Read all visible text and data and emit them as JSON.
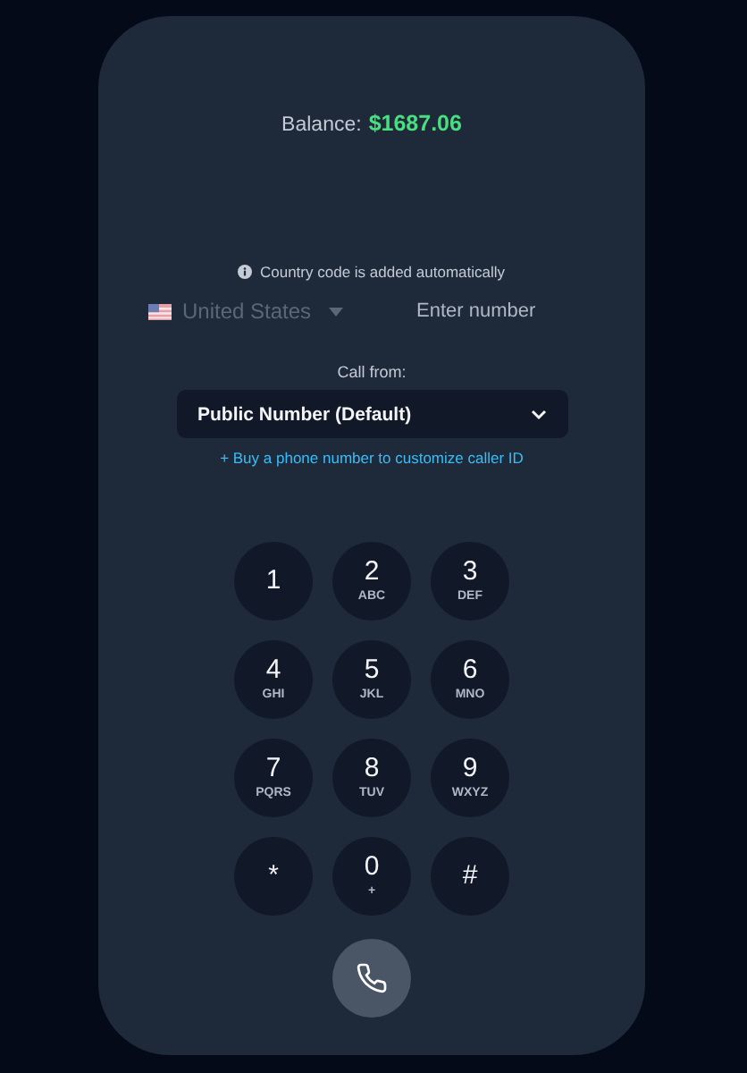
{
  "balance": {
    "label": "Balance:",
    "amount": "$1687.06"
  },
  "info": "Country code is added automatically",
  "country": {
    "name": "United States"
  },
  "number_field": {
    "placeholder": "Enter number"
  },
  "call_from": {
    "label": "Call from:",
    "value": "Public Number (Default)"
  },
  "buy_link": "+ Buy a phone number to customize caller ID",
  "keys": [
    {
      "digit": "1"
    },
    {
      "digit": "2",
      "letters": "ABC"
    },
    {
      "digit": "3",
      "letters": "DEF"
    },
    {
      "digit": "4",
      "letters": "GHI"
    },
    {
      "digit": "5",
      "letters": "JKL"
    },
    {
      "digit": "6",
      "letters": "MNO"
    },
    {
      "digit": "7",
      "letters": "PQRS"
    },
    {
      "digit": "8",
      "letters": "TUV"
    },
    {
      "digit": "9",
      "letters": "WXYZ"
    },
    {
      "digit": "*"
    },
    {
      "digit": "0",
      "letters": "+"
    },
    {
      "digit": "#"
    }
  ]
}
